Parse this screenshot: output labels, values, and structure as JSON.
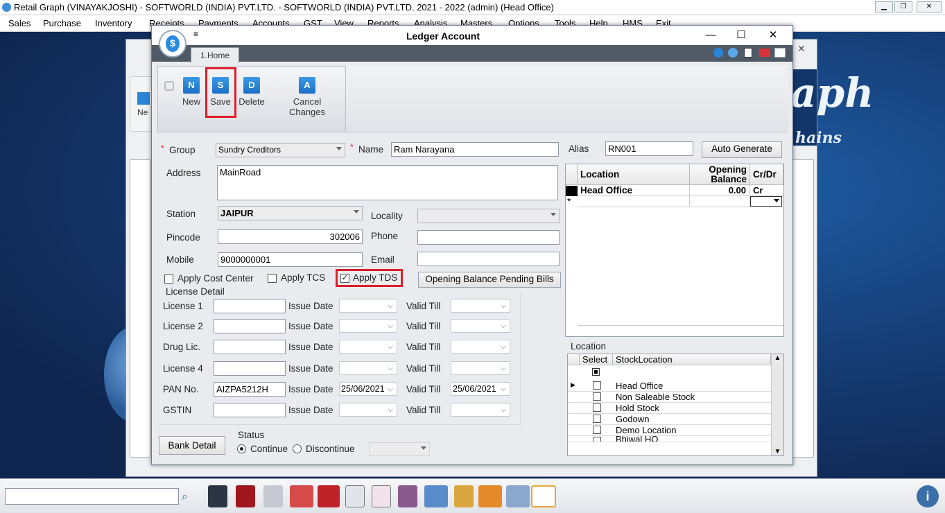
{
  "app": {
    "title": "Retail Graph (VINAYAKJOSHI) - SOFTWORLD (INDIA) PVT.LTD. - SOFTWORLD (INDIA) PVT.LTD.  2021 - 2022 (admin) (Head Office)",
    "menu": [
      "Sales",
      "Purchase",
      "Inventory",
      "Receipts",
      "Payments",
      "Accounts",
      "GST",
      "View",
      "Reports",
      "Analysis",
      "Masters",
      "Options",
      "Tools",
      "Help",
      "HMS",
      "Exit"
    ]
  },
  "background": {
    "brand": "aph",
    "brand_sub": "hains",
    "new_label": "Ne"
  },
  "dialog": {
    "title": "Ledger Account",
    "tab": "1.Home",
    "toolbar": {
      "new": "New",
      "save": "Save",
      "delete": "Delete",
      "cancel": "Cancel Changes",
      "icon_new": "N",
      "icon_save": "S",
      "icon_delete": "D",
      "icon_cancel": "A"
    },
    "labels": {
      "group": "Group",
      "name": "Name",
      "alias": "Alias",
      "address": "Address",
      "station": "Station",
      "locality": "Locality",
      "pincode": "Pincode",
      "phone": "Phone",
      "mobile": "Mobile",
      "email": "Email",
      "auto_generate": "Auto Generate",
      "apply_cost_center": "Apply Cost Center",
      "apply_tcs": "Apply TCS",
      "apply_tds": "Apply TDS",
      "opening_pending": "Opening Balance Pending Bills",
      "license_detail": "License Detail",
      "issue_date": "Issue Date",
      "valid_till": "Valid Till",
      "bank_detail": "Bank Detail",
      "status": "Status",
      "continue": "Continue",
      "discontinue": "Discontinue"
    },
    "values": {
      "group": "Sundry Creditors",
      "name": "Ram Narayana",
      "alias": "RN001",
      "address": "MainRoad",
      "station": "JAIPUR",
      "locality": "",
      "pincode": "302006",
      "phone": "",
      "mobile": "9000000001",
      "email": ""
    },
    "licenses": [
      {
        "label": "License 1",
        "number": "",
        "issue": "",
        "valid": ""
      },
      {
        "label": "License 2",
        "number": "",
        "issue": "",
        "valid": ""
      },
      {
        "label": "Drug Lic.",
        "number": "",
        "issue": "",
        "valid": ""
      },
      {
        "label": "License 4",
        "number": "",
        "issue": "",
        "valid": ""
      },
      {
        "label": "PAN No.",
        "number": "AIZPA5212H",
        "issue": "25/06/2021",
        "valid": "25/06/2021"
      },
      {
        "label": "GSTIN",
        "number": "",
        "issue": "",
        "valid": ""
      }
    ],
    "location_grid": {
      "headers": {
        "location": "Location",
        "opening": "Opening",
        "balance": "Balance",
        "crdr": "Cr/Dr"
      },
      "rows": [
        {
          "location": "Head Office",
          "balance": "0.00",
          "crdr": "Cr"
        }
      ],
      "new_row_marker": "*"
    },
    "stock_location": {
      "title": "Location",
      "headers": {
        "select": "Select",
        "stock": "StockLocation"
      },
      "items": [
        "Head Office",
        "Non Saleable Stock",
        "Hold Stock",
        "Godown",
        "Demo Location",
        "Bhiwal HO"
      ]
    }
  }
}
